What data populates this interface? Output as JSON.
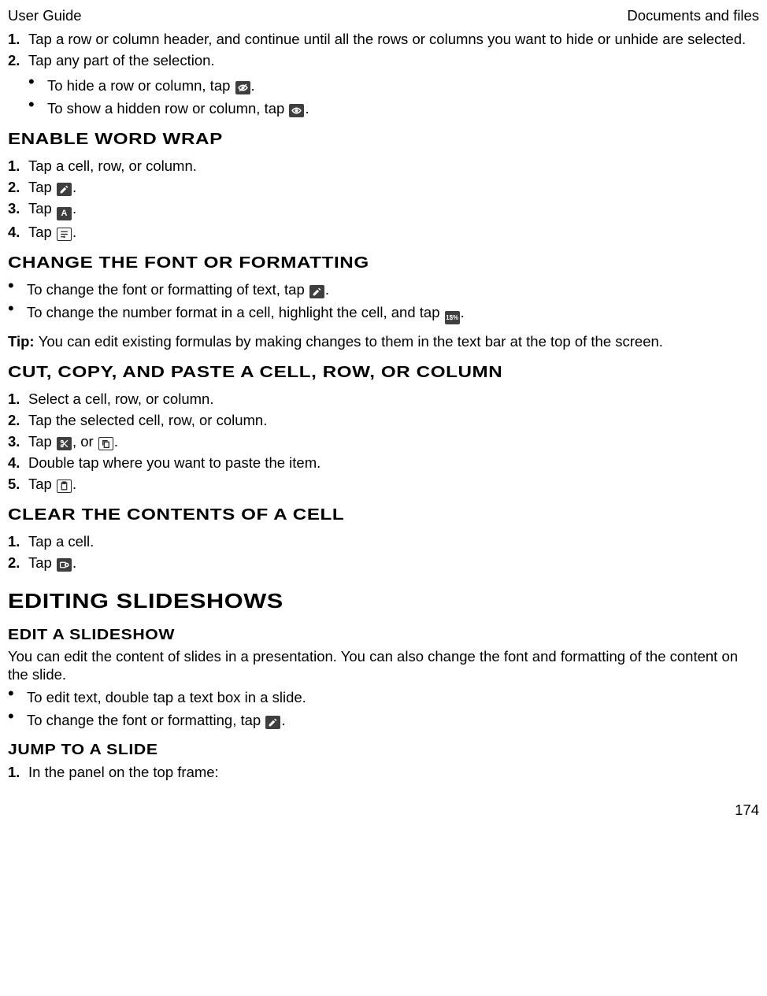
{
  "header": {
    "left": "User Guide",
    "right": "Documents and files"
  },
  "intro_steps": {
    "s1": "Tap a row or column header, and continue until all the rows or columns you want to hide or unhide are selected.",
    "s2": "Tap any part of the selection.",
    "b1a": "To hide a row or column, tap ",
    "b2a": "To show a hidden row or column, tap "
  },
  "word_wrap": {
    "title": "Enable word wrap",
    "s1": "Tap a cell, row, or column.",
    "s2a": "Tap ",
    "s3a": "Tap ",
    "s4a": "Tap "
  },
  "font_fmt": {
    "title": "Change the font or formatting",
    "b1a": "To change the font or formatting of text, tap ",
    "b2a": "To change the number format in a cell, highlight the cell, and tap ",
    "tip_label": "Tip: ",
    "tip_text": "You can edit existing formulas by making changes to them in the text bar at the top of the screen."
  },
  "ccp": {
    "title": "Cut, copy, and paste a cell, row, or column",
    "s1": "Select a cell, row, or column.",
    "s2": "Tap the selected cell, row, or column.",
    "s3a": "Tap ",
    "s3b": ", or ",
    "s4": "Double tap where you want to paste the item.",
    "s5a": "Tap "
  },
  "clear": {
    "title": "Clear the contents of a cell",
    "s1": "Tap a cell.",
    "s2a": "Tap "
  },
  "slides": {
    "h1": "Editing slideshows",
    "h2": "Edit a slideshow",
    "intro": "You can edit the content of slides in a presentation. You can also change the font and formatting of the content on the slide.",
    "b1": "To edit text, double tap a text box in a slide.",
    "b2a": "To change the font or formatting, tap ",
    "jump_title": "Jump to a slide",
    "js1": "In the panel on the top frame:"
  },
  "page": "174",
  "period": "."
}
